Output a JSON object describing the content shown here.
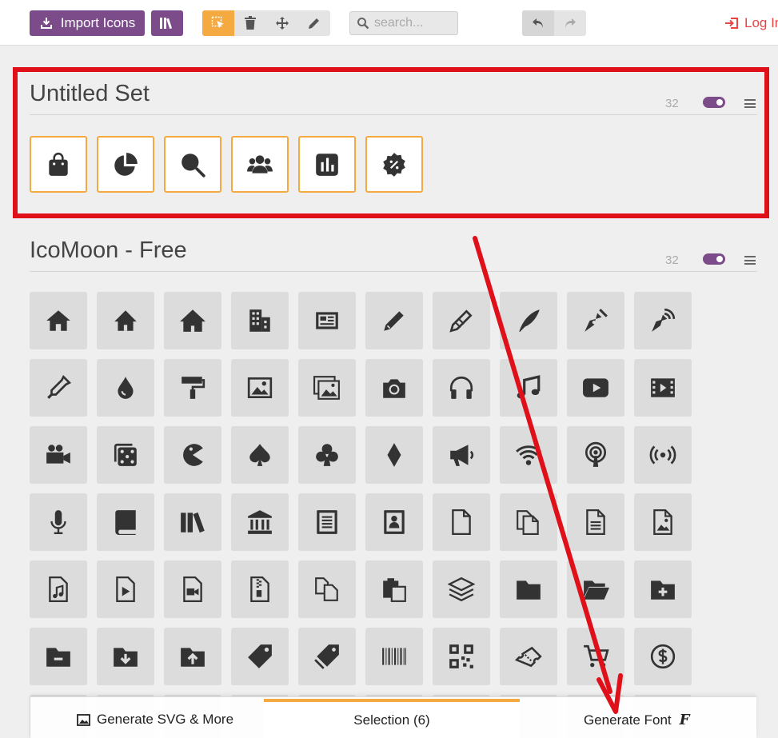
{
  "toolbar": {
    "import_label": "Import Icons",
    "search_placeholder": "search...",
    "login_label": "Log In"
  },
  "sets": [
    {
      "title": "Untitled Set",
      "count": "32",
      "enabled": true,
      "selected_icons": [
        "bag-icon",
        "pie-chart-icon",
        "search-icon",
        "users-icon",
        "stats-icon",
        "discount-badge-icon"
      ]
    },
    {
      "title": "IcoMoon - Free",
      "count": "32",
      "enabled": true,
      "icons": [
        "home-icon",
        "home2-icon",
        "home3-icon",
        "office-icon",
        "newspaper-icon",
        "pencil-icon",
        "pencil2-icon",
        "quill-icon",
        "pen-icon",
        "blog-icon",
        "eyedropper-icon",
        "droplet-icon",
        "paint-format-icon",
        "image-icon",
        "images-icon",
        "camera-icon",
        "headphones-icon",
        "music-icon",
        "play-icon",
        "film-icon",
        "video-camera-icon",
        "dice-icon",
        "pacman-icon",
        "spades-icon",
        "clubs-icon",
        "diamonds-icon",
        "bullhorn-icon",
        "connection-icon",
        "podcast-icon",
        "feed-icon",
        "mic-icon",
        "book-icon",
        "books-icon",
        "library-icon",
        "file-text-icon",
        "profile-icon",
        "file-empty-icon",
        "files-empty-icon",
        "file-text2-icon",
        "file-picture-icon",
        "file-music-icon",
        "file-play-icon",
        "file-video-icon",
        "file-zip-icon",
        "copy-icon",
        "paste-icon",
        "stack-icon",
        "folder-icon",
        "folder-open-icon",
        "folder-plus-icon",
        "folder-minus-icon",
        "folder-download-icon",
        "folder-upload-icon",
        "price-tag-icon",
        "price-tags-icon",
        "barcode-icon",
        "qrcode-icon",
        "ticket-icon",
        "cart-icon",
        "coin-dollar-icon"
      ]
    }
  ],
  "bottom": {
    "generate_svg_label": "Generate SVG & More",
    "selection_label": "Selection (6)",
    "generate_font_label": "Generate Font",
    "font_glyph": "F"
  },
  "annotation": {
    "highlight_color": "#e0101a",
    "arrow_color": "#e0101a"
  }
}
